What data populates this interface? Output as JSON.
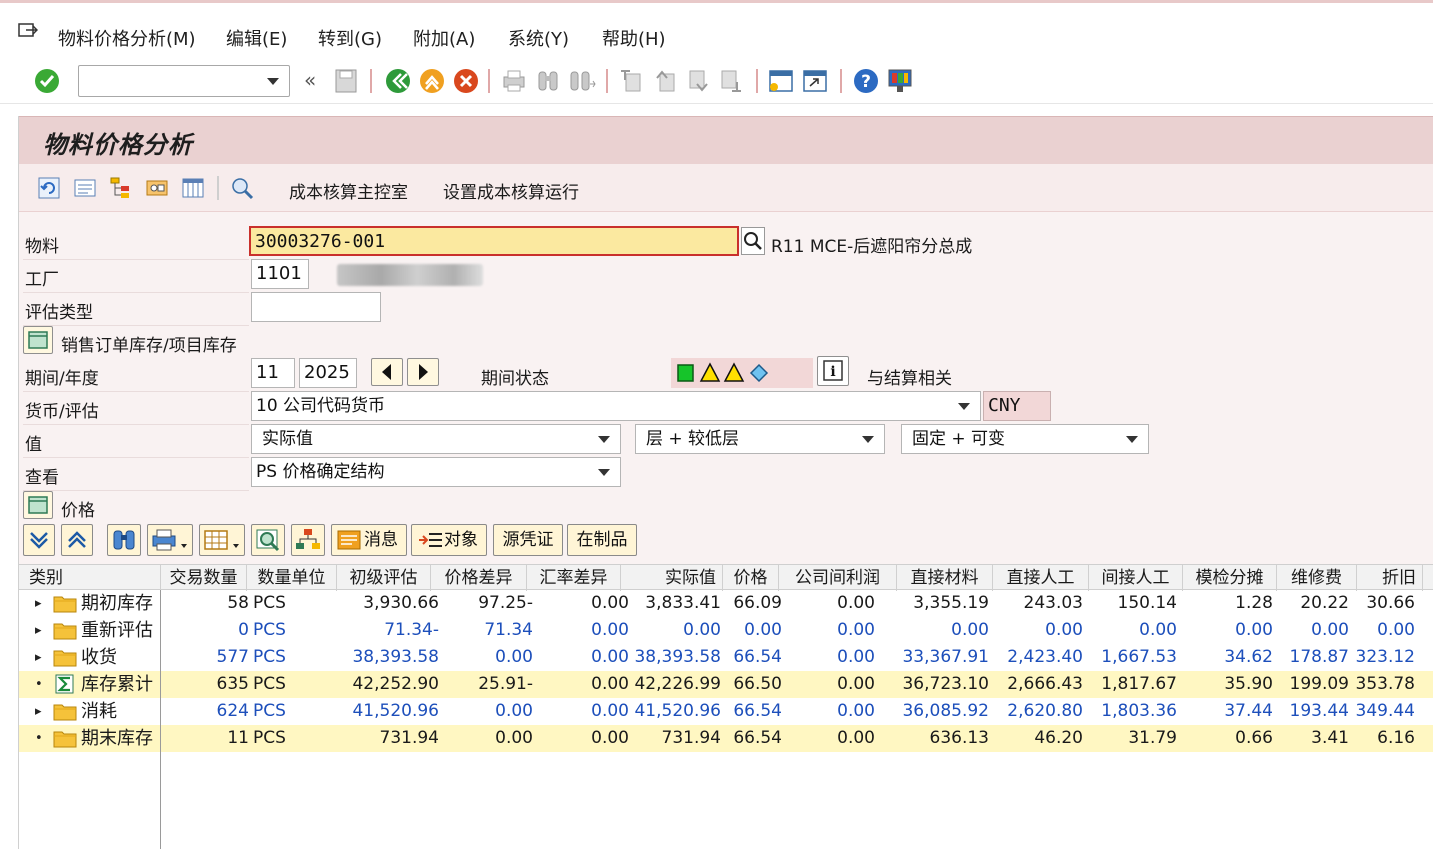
{
  "menu": {
    "items": [
      "物料价格分析(M)",
      "编辑(E)",
      "转到(G)",
      "附加(A)",
      "系统(Y)",
      "帮助(H)"
    ]
  },
  "system_toolbar": {
    "command_field_value": "",
    "icons": [
      "enter-check-icon",
      "save-icon",
      "back-icon",
      "exit-icon",
      "cancel-icon",
      "print-icon",
      "find-icon",
      "find-next-icon",
      "first-page-icon",
      "prev-page-icon",
      "next-page-icon",
      "last-page-icon",
      "new-session-icon",
      "shortcut-icon",
      "help-icon",
      "customize-layout-icon"
    ]
  },
  "screen": {
    "title": "物料价格分析",
    "app_toolbar": {
      "cost_cockpit_label": "成本核算主控室",
      "set_costing_run_label": "设置成本核算运行"
    }
  },
  "form": {
    "material_label": "物料",
    "material_value": "30003276-001",
    "material_desc": "R11 MCE-后遮阳帘分总成",
    "plant_label": "工厂",
    "plant_value": "1101",
    "valuation_type_label": "评估类型",
    "valuation_type_value": "",
    "sales_order_stock_label": "销售订单库存/项目库存",
    "period_year_label": "期间/年度",
    "period_value": "11",
    "year_value": "2025",
    "period_status_label": "期间状态",
    "settlement_label": "与结算相关",
    "currency_label": "货币/评估",
    "currency_value": "10 公司代码货币",
    "currency_code": "CNY",
    "value_label": "值",
    "value_select_1": "实际值",
    "value_select_2": "层 + 较低层",
    "value_select_3": "固定 + 可变",
    "view_label": "查看",
    "view_value": "PS 价格确定结构",
    "price_section_label": "价格"
  },
  "grid_toolbar": {
    "messages_label": "消息",
    "objects_label": "对象",
    "source_doc_label": "源凭证",
    "wip_label": "在制品"
  },
  "grid": {
    "columns": [
      "类别",
      "交易数量",
      "数量单位",
      "初级评估",
      "价格差异",
      "汇率差异",
      "实际值",
      "价格",
      "公司间利润",
      "直接材料",
      "直接人工",
      "间接人工",
      "模检分摊",
      "维修费",
      "折旧"
    ],
    "rows": [
      {
        "category": "期初库存",
        "icon": "folder-icon",
        "expand": "▸",
        "highlight": false,
        "blue": false,
        "cells": [
          "58",
          "PCS",
          "3,930.66",
          "97.25-",
          "0.00",
          "3,833.41",
          "66.09",
          "0.00",
          "3,355.19",
          "243.03",
          "150.14",
          "1.28",
          "20.22",
          "30.66"
        ]
      },
      {
        "category": "重新评估",
        "icon": "folder-icon",
        "expand": "▸",
        "highlight": false,
        "blue": true,
        "cells": [
          "0",
          "PCS",
          "71.34-",
          "71.34",
          "0.00",
          "0.00",
          "0.00",
          "0.00",
          "0.00",
          "0.00",
          "0.00",
          "0.00",
          "0.00",
          "0.00"
        ]
      },
      {
        "category": "收货",
        "icon": "folder-icon",
        "expand": "▸",
        "highlight": false,
        "blue": true,
        "cells": [
          "577",
          "PCS",
          "38,393.58",
          "0.00",
          "0.00",
          "38,393.58",
          "66.54",
          "0.00",
          "33,367.91",
          "2,423.40",
          "1,667.53",
          "34.62",
          "178.87",
          "323.12"
        ]
      },
      {
        "category": "库存累计",
        "icon": "sum-icon",
        "expand": "•",
        "highlight": true,
        "blue": false,
        "cells": [
          "635",
          "PCS",
          "42,252.90",
          "25.91-",
          "0.00",
          "42,226.99",
          "66.50",
          "0.00",
          "36,723.10",
          "2,666.43",
          "1,817.67",
          "35.90",
          "199.09",
          "353.78"
        ]
      },
      {
        "category": "消耗",
        "icon": "folder-icon",
        "expand": "▸",
        "highlight": false,
        "blue": true,
        "cells": [
          "624",
          "PCS",
          "41,520.96",
          "0.00",
          "0.00",
          "41,520.96",
          "66.54",
          "0.00",
          "36,085.92",
          "2,620.80",
          "1,803.36",
          "37.44",
          "193.44",
          "349.44"
        ]
      },
      {
        "category": "期末库存",
        "icon": "folder-icon",
        "expand": "•",
        "highlight": true,
        "blue": false,
        "cells": [
          "11",
          "PCS",
          "731.94",
          "0.00",
          "0.00",
          "731.94",
          "66.54",
          "0.00",
          "636.13",
          "46.20",
          "31.79",
          "0.66",
          "3.41",
          "6.16"
        ]
      }
    ]
  },
  "colors": {
    "title_bg": "#ead1d1",
    "panel_bg": "#f9f2f2",
    "highlight_row": "#fff7c2",
    "link_blue": "#1d4fbb",
    "input_yellow": "#fbe9a0"
  }
}
